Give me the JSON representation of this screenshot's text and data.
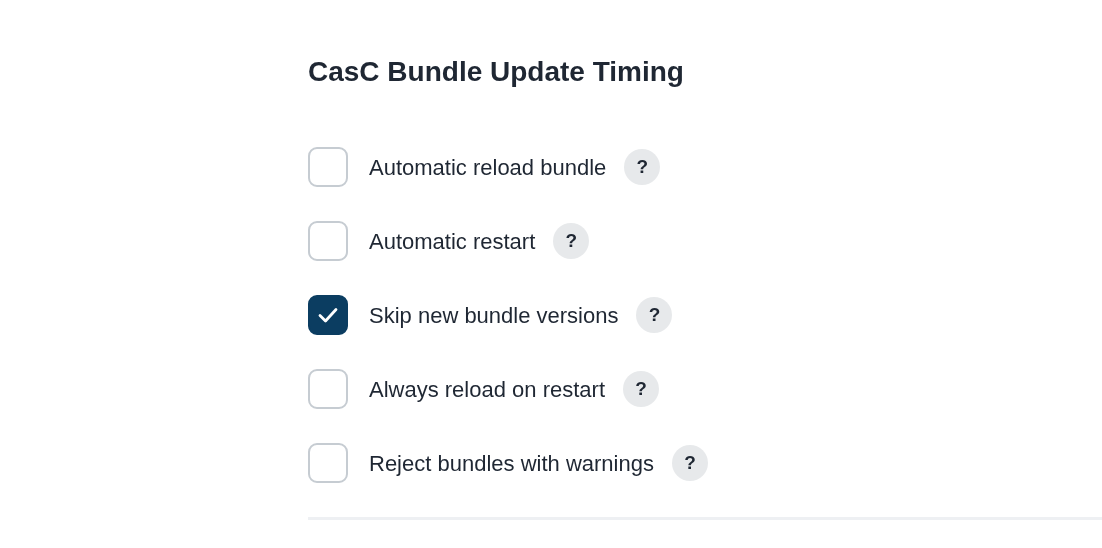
{
  "section": {
    "title": "CasC Bundle Update Timing"
  },
  "options": [
    {
      "label": "Automatic reload bundle",
      "checked": false,
      "help": "?"
    },
    {
      "label": "Automatic restart",
      "checked": false,
      "help": "?"
    },
    {
      "label": "Skip new bundle versions",
      "checked": true,
      "help": "?"
    },
    {
      "label": "Always reload on restart",
      "checked": false,
      "help": "?"
    },
    {
      "label": "Reject bundles with warnings",
      "checked": false,
      "help": "?"
    }
  ]
}
